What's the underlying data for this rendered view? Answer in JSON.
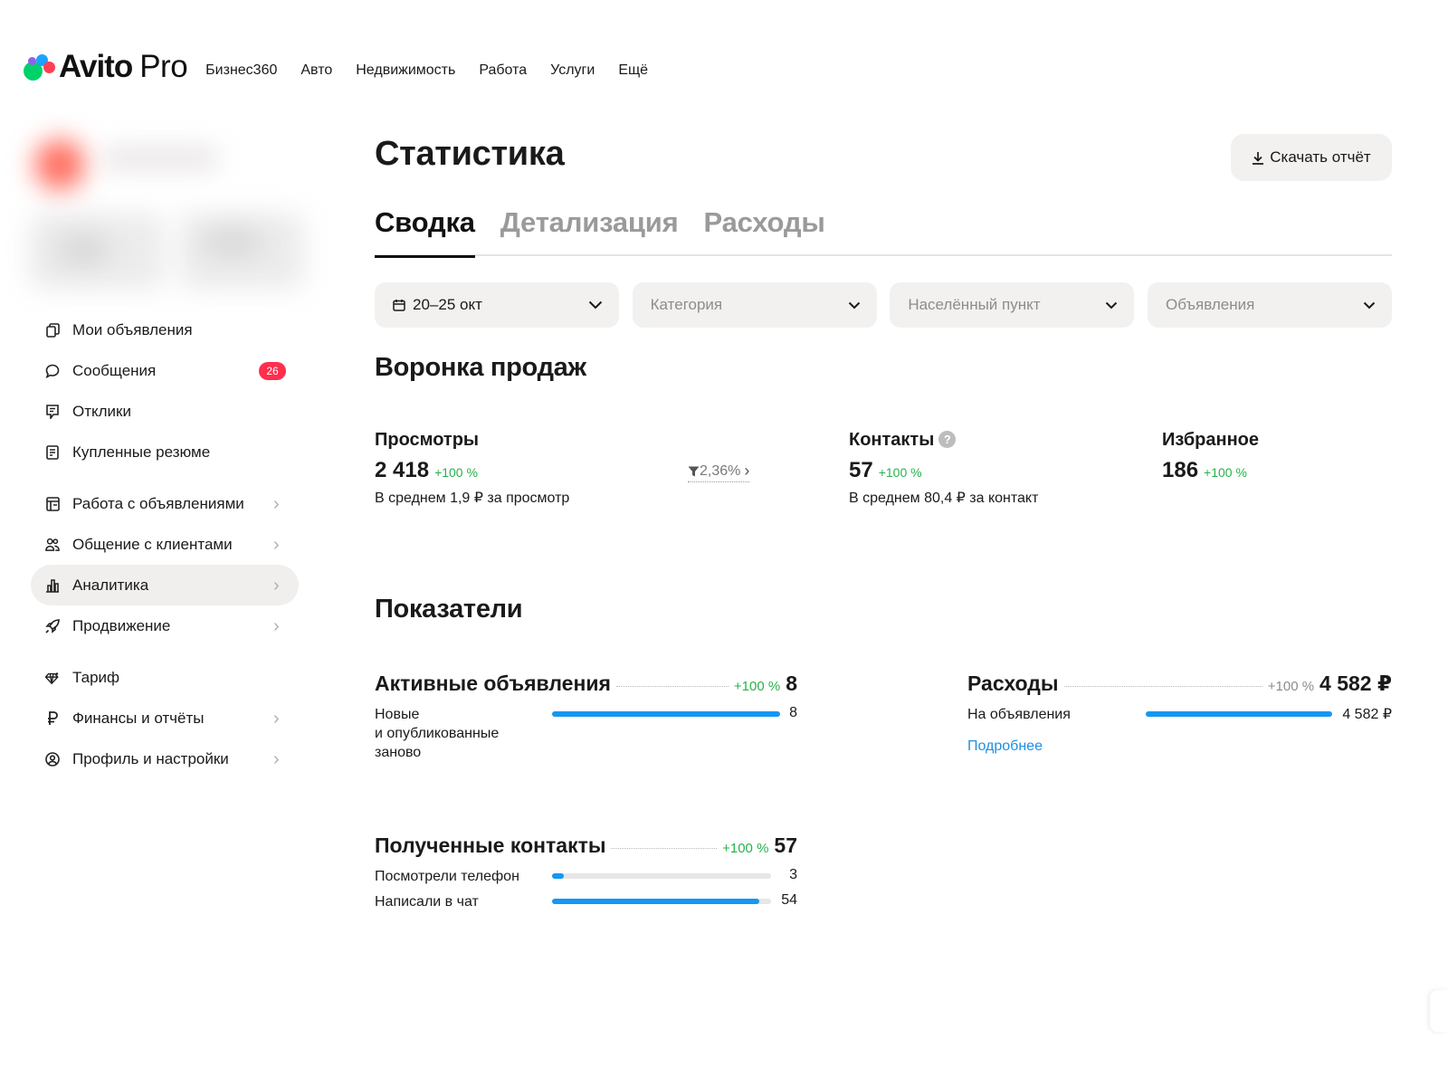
{
  "header": {
    "logo_text": "Avito",
    "logo_pro": "Pro",
    "nav": [
      "Бизнес360",
      "Авто",
      "Недвижимость",
      "Работа",
      "Услуги",
      "Ещё"
    ]
  },
  "sidebar": {
    "items": [
      {
        "label": "Мои объявления",
        "icon": "listings-icon"
      },
      {
        "label": "Сообщения",
        "icon": "chat-icon",
        "badge": "26"
      },
      {
        "label": "Отклики",
        "icon": "responses-icon"
      },
      {
        "label": "Купленные резюме",
        "icon": "resume-icon"
      },
      {
        "label": "Работа с объявлениями",
        "icon": "ads-work-icon"
      },
      {
        "label": "Общение с клиентами",
        "icon": "clients-icon"
      },
      {
        "label": "Аналитика",
        "icon": "analytics-icon"
      },
      {
        "label": "Продвижение",
        "icon": "rocket-icon"
      },
      {
        "label": "Тариф",
        "icon": "diamond-icon"
      },
      {
        "label": "Финансы и отчёты",
        "icon": "ruble-icon"
      },
      {
        "label": "Профиль и настройки",
        "icon": "profile-icon"
      }
    ],
    "active": "Аналитика"
  },
  "main": {
    "title": "Статистика",
    "download_label": "Скачать отчёт",
    "tabs": [
      "Сводка",
      "Детализация",
      "Расходы"
    ],
    "active_tab": "Сводка",
    "filters": {
      "date": "20–25 окт",
      "category": "Категория",
      "location": "Населённый пункт",
      "ads": "Объявления"
    },
    "funnel": {
      "title": "Воронка продаж",
      "views": {
        "label": "Просмотры",
        "value": "2 418",
        "delta": "+100 %",
        "sub": "В среднем 1,9 ₽ за просмотр"
      },
      "conversion": "2,36%",
      "contacts": {
        "label": "Контакты",
        "value": "57",
        "delta": "+100 %",
        "sub": "В среднем 80,4 ₽ за контакт"
      },
      "favorites": {
        "label": "Избранное",
        "value": "186",
        "delta": "+100 %"
      }
    },
    "indicators": {
      "title": "Показатели",
      "active_ads": {
        "title": "Активные объявления",
        "delta": "+100 %",
        "total": "8",
        "rows": [
          {
            "label": "Новые\nи опубликованные\nзаново",
            "value": "8",
            "fraction": 1.0
          }
        ]
      },
      "expenses": {
        "title": "Расходы",
        "delta": "+100 %",
        "total": "4 582 ₽",
        "rows": [
          {
            "label": "На объявления",
            "value": "4 582 ₽",
            "fraction": 1.0
          }
        ],
        "link": "Подробнее"
      },
      "contacts": {
        "title": "Полученные контакты",
        "delta": "+100 %",
        "total": "57",
        "rows": [
          {
            "label": "Посмотрели телефон",
            "value": "3",
            "fraction": 0.053
          },
          {
            "label": "Написали в чат",
            "value": "54",
            "fraction": 0.947
          }
        ]
      }
    }
  },
  "colors": {
    "accent_blue": "#1597f2",
    "delta_green": "#27b24a",
    "badge_red": "#ff2e4d",
    "link": "#1f8fe0"
  }
}
